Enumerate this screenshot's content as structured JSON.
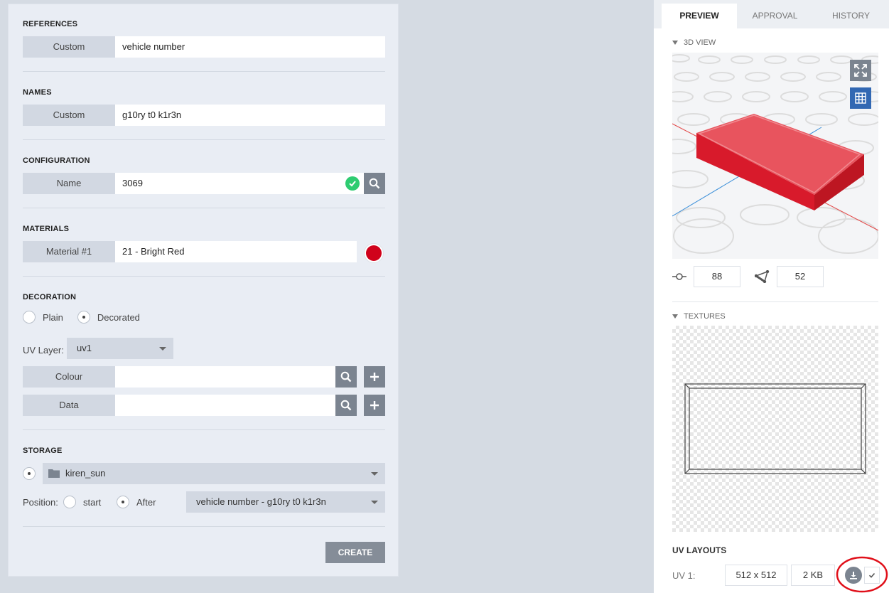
{
  "form": {
    "references": {
      "title": "REFERENCES",
      "label": "Custom",
      "value": "vehicle number"
    },
    "names": {
      "title": "NAMES",
      "label": "Custom",
      "value": "g10ry t0 k1r3n"
    },
    "configuration": {
      "title": "CONFIGURATION",
      "label": "Name",
      "value": "3069",
      "status": "valid"
    },
    "materials": {
      "title": "MATERIALS",
      "label": "Material #1",
      "value": "21 - Bright Red",
      "swatch_color": "#d0021b"
    },
    "decoration": {
      "title": "DECORATION",
      "options": [
        "Plain",
        "Decorated"
      ],
      "selected": "Decorated",
      "uv_layer_label": "UV Layer:",
      "uv_layer_value": "uv1",
      "colour_label": "Colour",
      "colour_value": "",
      "data_label": "Data",
      "data_value": ""
    },
    "storage": {
      "title": "STORAGE",
      "folder": "kiren_sun",
      "position_label": "Position:",
      "position_options": [
        "start",
        "After"
      ],
      "position_selected": "After",
      "after_value": "vehicle number - g10ry t0 k1r3n"
    },
    "create_label": "CREATE"
  },
  "preview": {
    "tabs": [
      {
        "label": "PREVIEW",
        "active": true
      },
      {
        "label": "APPROVAL",
        "active": false
      },
      {
        "label": "HISTORY",
        "active": false
      }
    ],
    "view3d_title": "3D VIEW",
    "vertices": "88",
    "triangles": "52",
    "textures_title": "TEXTURES",
    "uv_layouts_title": "UV LAYOUTS",
    "uv1_label": "UV 1:",
    "uv1_size": "512 x 512",
    "uv1_filesize": "2 KB"
  },
  "colors": {
    "accent_blue": "#3268b3",
    "valid_green": "#2ecc71",
    "brick_red": "#e0222e",
    "annotation_red": "#e0101a"
  }
}
